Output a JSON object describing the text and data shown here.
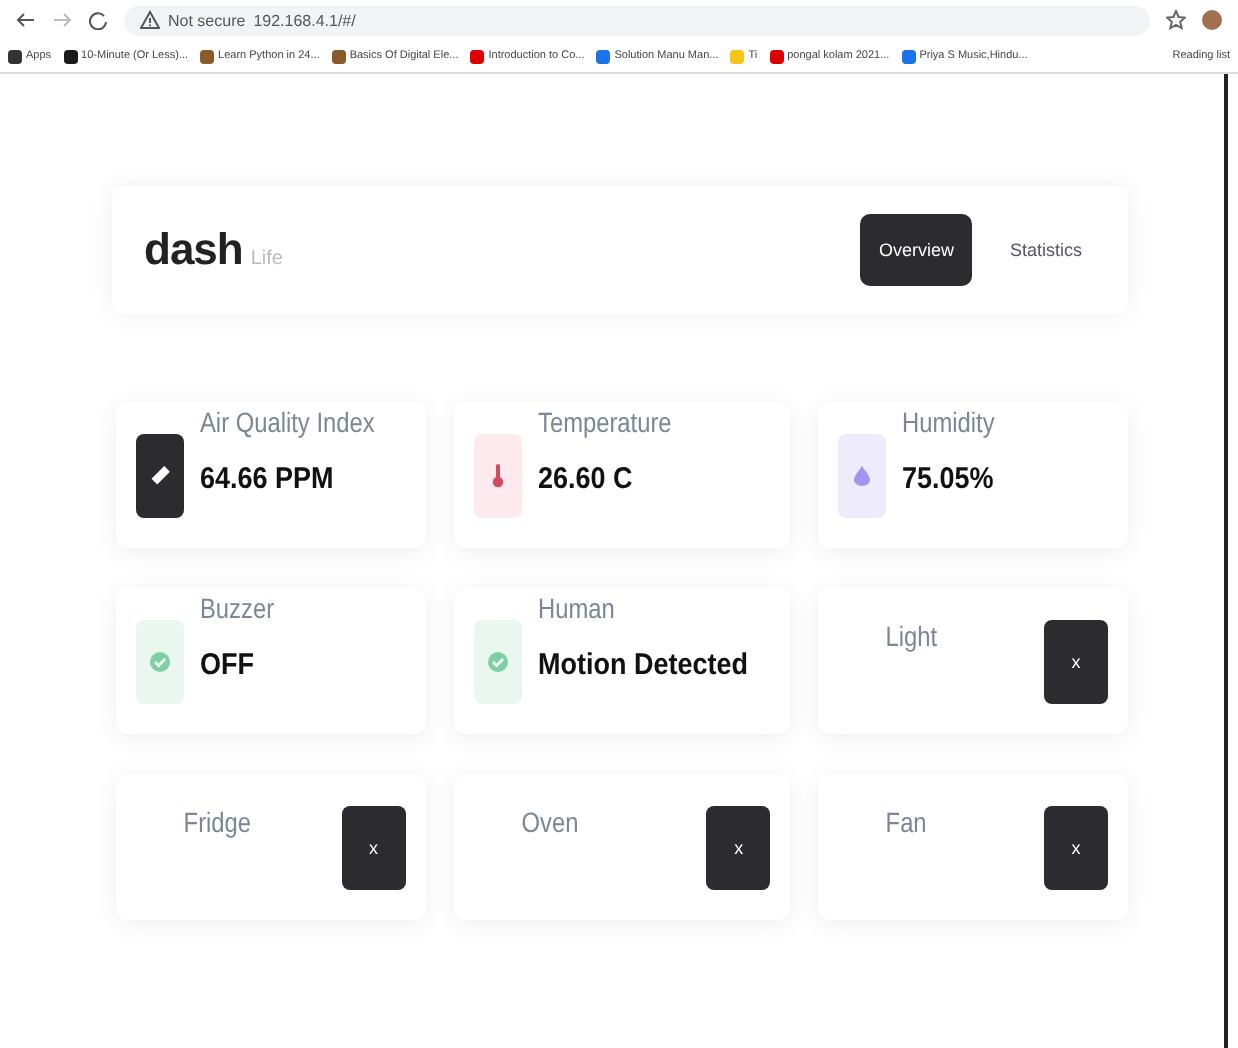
{
  "browser": {
    "address_secure_label": "Not secure",
    "address": "192.168.4.1/#/",
    "bookmarks": [
      "Apps",
      "10-Minute (Or Less)...",
      "Learn Python in 24...",
      "Basics Of Digital Ele...",
      "Introduction to Co...",
      "Solution Manu Man...",
      "Ti",
      "pongal kolam 2021...",
      "Priya S Music,Hindu..."
    ],
    "reading_list": "Reading list"
  },
  "header": {
    "logo": "dash",
    "logo_suffix": "Life",
    "tabs": [
      {
        "label": "Overview",
        "selected": true
      },
      {
        "label": "Statistics",
        "selected": false
      }
    ]
  },
  "cards": [
    {
      "kind": "gauge",
      "label": "Air Quality Index",
      "value": "64.66 PPM",
      "color": "#2b2b30"
    },
    {
      "kind": "thermo",
      "label": "Temperature",
      "value": "26.60 C",
      "color": "#fdeaee"
    },
    {
      "kind": "drop",
      "label": "Humidity",
      "value": "75.05%",
      "color": "#eeebfd"
    },
    {
      "kind": "check",
      "label": "Buzzer",
      "value": "OFF",
      "color": "#e9f7ef"
    },
    {
      "kind": "check",
      "label": "Human",
      "value": "Motion Detected",
      "color": "#e9f7ef"
    },
    {
      "kind": "switch",
      "label": "Light",
      "button": "x"
    },
    {
      "kind": "switch",
      "label": "Fridge",
      "button": "x"
    },
    {
      "kind": "switch",
      "label": "Oven",
      "button": "x"
    },
    {
      "kind": "switch",
      "label": "Fan",
      "button": "x"
    }
  ]
}
